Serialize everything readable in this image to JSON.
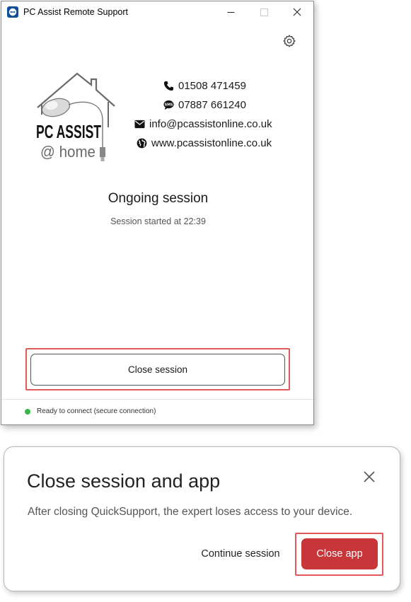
{
  "window": {
    "title": "PC Assist Remote Support",
    "minimize_glyph": "—",
    "maximize_glyph": "☐",
    "close_glyph": "✕"
  },
  "contacts": {
    "phone": "01508 471459",
    "sms": "07887 661240",
    "email": "info@pcassistonline.co.uk",
    "website": "www.pcassistonline.co.uk"
  },
  "logo": {
    "line1": "PC ASSIST",
    "line2": "@ home"
  },
  "session": {
    "title": "Ongoing session",
    "subtitle": "Session started at 22:39",
    "close_button": "Close session"
  },
  "status": {
    "text": "Ready to connect (secure connection)",
    "color": "#3bb54a"
  },
  "dialog": {
    "title": "Close session and app",
    "message": "After closing QuickSupport, the expert loses access to your device.",
    "continue_label": "Continue session",
    "close_app_label": "Close app"
  },
  "colors": {
    "accent_red": "#c8363a",
    "highlight": "#e05a5a",
    "app_icon_blue": "#0e4f97"
  },
  "icons": [
    "teamviewer-app-icon",
    "gear-icon",
    "phone-icon",
    "sms-icon",
    "envelope-icon",
    "globe-icon",
    "close-icon"
  ]
}
